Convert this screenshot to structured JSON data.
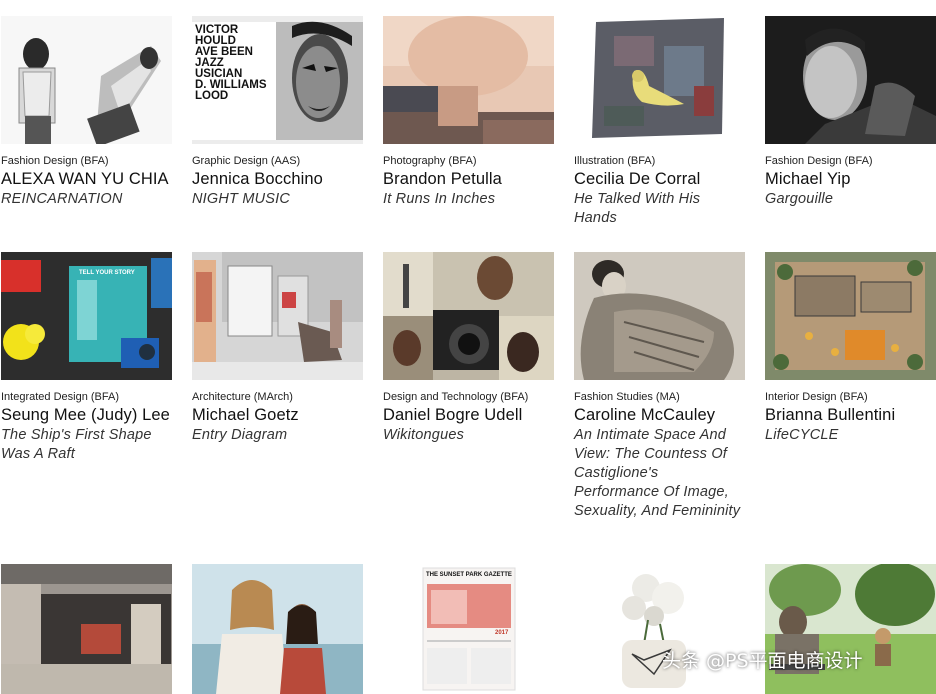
{
  "cards": [
    {
      "department": "Fashion Design (BFA)",
      "name": "ALEXA WAN YU CHIA",
      "title": "REINCARNATION"
    },
    {
      "department": "Graphic Design (AAS)",
      "name": "Jennica Bocchino",
      "title": "NIGHT MUSIC",
      "image_text": [
        "VICTOR",
        "HOULD",
        "AVE BEEN",
        "JAZZ",
        "USICIAN",
        "D. WILLIAMS",
        "LOOD"
      ]
    },
    {
      "department": "Photography (BFA)",
      "name": "Brandon Petulla",
      "title": "It Runs In Inches"
    },
    {
      "department": "Illustration (BFA)",
      "name": "Cecilia De Corral",
      "title": "He Talked With His Hands"
    },
    {
      "department": "Fashion Design (BFA)",
      "name": "Michael Yip",
      "title": "Gargouille"
    },
    {
      "department": "Integrated Design (BFA)",
      "name": "Seung Mee (Judy) Lee",
      "title": "The Ship's First Shape Was A Raft",
      "image_text": [
        "TELL YOUR STORY"
      ]
    },
    {
      "department": "Architecture (MArch)",
      "name": "Michael Goetz",
      "title": "Entry Diagram"
    },
    {
      "department": "Design and Technology (BFA)",
      "name": "Daniel Bogre Udell",
      "title": "Wikitongues"
    },
    {
      "department": "Fashion Studies (MA)",
      "name": "Caroline McCauley",
      "title": "An Intimate Space And View: The Countess Of Castiglione's Performance Of Image, Sexuality, And Femininity"
    },
    {
      "department": "Interior Design (BFA)",
      "name": "Brianna Bullentini",
      "title": "LifeCYCLE"
    },
    {
      "department": "",
      "name": "",
      "title": ""
    },
    {
      "department": "",
      "name": "",
      "title": ""
    },
    {
      "department": "",
      "name": "",
      "title": "",
      "image_text": [
        "THE SUNSET PARK GAZETTE",
        "2017"
      ]
    },
    {
      "department": "",
      "name": "",
      "title": ""
    },
    {
      "department": "",
      "name": "",
      "title": ""
    }
  ],
  "watermark": "头条 @PS平面电商设计"
}
